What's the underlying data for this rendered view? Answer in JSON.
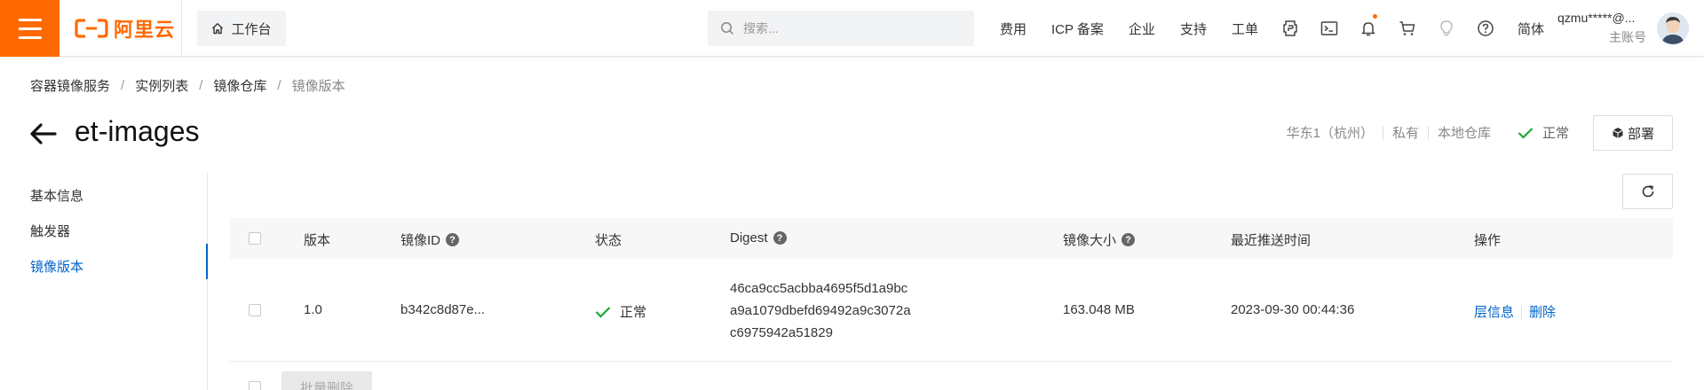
{
  "brand": {
    "name": "阿里云",
    "color": "#ff6a00"
  },
  "topbar": {
    "workbench_label": "工作台",
    "search_placeholder": "搜索...",
    "nav_links": [
      "费用",
      "ICP 备案",
      "企业",
      "支持",
      "工单"
    ],
    "icons": [
      "cloudshell-icon",
      "terminal-icon",
      "bell-icon",
      "cart-icon",
      "lightbulb-icon",
      "help-icon"
    ],
    "language": "简体",
    "user_name": "qzmu*****@...",
    "user_role": "主账号"
  },
  "breadcrumb": [
    "容器镜像服务",
    "实例列表",
    "镜像仓库",
    "镜像版本"
  ],
  "header": {
    "title": "et-images",
    "region": "华东1（杭州）",
    "visibility": "私有",
    "repo_type": "本地仓库",
    "status": "正常",
    "deploy_label": "部署"
  },
  "left_menu": {
    "items": [
      "基本信息",
      "触发器",
      "镜像版本"
    ],
    "active_index": 2
  },
  "table": {
    "columns": {
      "version": "版本",
      "image_id": "镜像ID",
      "status": "状态",
      "digest": "Digest",
      "size": "镜像大小",
      "pushed": "最近推送时间",
      "ops": "操作"
    },
    "rows": [
      {
        "version": "1.0",
        "image_id": "b342c8d87e...",
        "status": "正常",
        "digest_lines": [
          "46ca9cc5acbba4695f5d1a9bc",
          "a9a1079dbefd69492a9c3072a",
          "c6975942a51829"
        ],
        "size": "163.048 MB",
        "pushed": "2023-09-30 00:44:36",
        "op_layers": "层信息",
        "op_delete": "删除"
      }
    ],
    "batch_delete_label": "批量删除"
  },
  "colors": {
    "accent": "#ff6a00",
    "link": "#0064c8",
    "success": "#1ea835"
  }
}
